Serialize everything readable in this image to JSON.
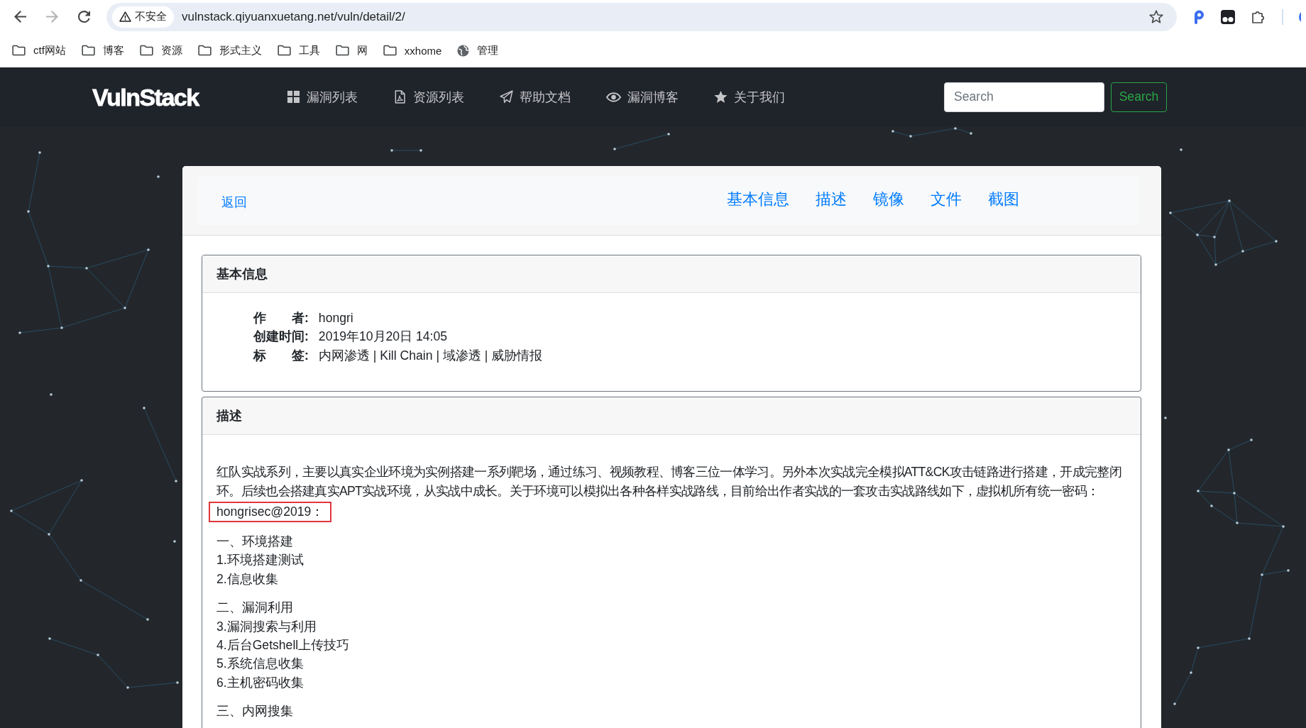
{
  "browser": {
    "nav_buttons": [
      {
        "kind": "back",
        "disabled": false
      },
      {
        "kind": "forward",
        "disabled": true
      },
      {
        "kind": "reload",
        "disabled": false
      }
    ],
    "security_label": "不安全",
    "url": "vulnstack.qiyuanxuetang.net/vuln/detail/2/",
    "bookmarks": [
      {
        "kind": "folder",
        "label": "ctf网站"
      },
      {
        "kind": "folder",
        "label": "博客"
      },
      {
        "kind": "folder",
        "label": "资源"
      },
      {
        "kind": "folder",
        "label": "形式主义"
      },
      {
        "kind": "folder",
        "label": "工具"
      },
      {
        "kind": "folder",
        "label": "网"
      },
      {
        "kind": "folder",
        "label": "xxhome"
      },
      {
        "kind": "site",
        "label": "管理"
      }
    ]
  },
  "navbar": {
    "logo": "VulnStack",
    "links": [
      "漏洞列表",
      "资源列表",
      "帮助文档",
      "漏洞博客",
      "关于我们"
    ],
    "search": {
      "placeholder": "Search"
    },
    "search_button": "Search"
  },
  "detail": {
    "back_link": "返回",
    "tabs": [
      "基本信息",
      "描述",
      "镜像",
      "文件",
      "截图"
    ],
    "info_panel": {
      "title": "基本信息",
      "fields": [
        {
          "label": "作　　者:",
          "value": "hongri"
        },
        {
          "label": "创建时间:",
          "value": "2019年10月20日 14:05"
        },
        {
          "label": "标　　签:",
          "value": "内网渗透 | Kill Chain | 域渗透 | 威胁情报"
        }
      ]
    },
    "description_panel": {
      "title": "描述",
      "paragraph": "红队实战系列，主要以真实企业环境为实例搭建一系列靶场，通过练习、视频教程、博客三位一体学习。另外本次实战完全模拟ATT&CK攻击链路进行搭建，开成完整闭环。后续也会搭建真实APT实战环境，从实战中成长。关于环境可以模拟出各种各样实战路线，目前给出作者实战的一套攻击实战路线如下，虚拟机所有统一密码：",
      "password": {
        "text": "hongrisec@2019：",
        "highlighted": true
      },
      "sections": [
        {
          "title": "一、环境搭建",
          "items": [
            "1.环境搭建测试",
            "2.信息收集"
          ]
        },
        {
          "title": "二、漏洞利用",
          "items": [
            "3.漏洞搜索与利用",
            "4.后台Getshell上传技巧",
            "5.系统信息收集",
            "6.主机密码收集"
          ]
        },
        {
          "title": "三、内网搜集"
        }
      ]
    }
  }
}
